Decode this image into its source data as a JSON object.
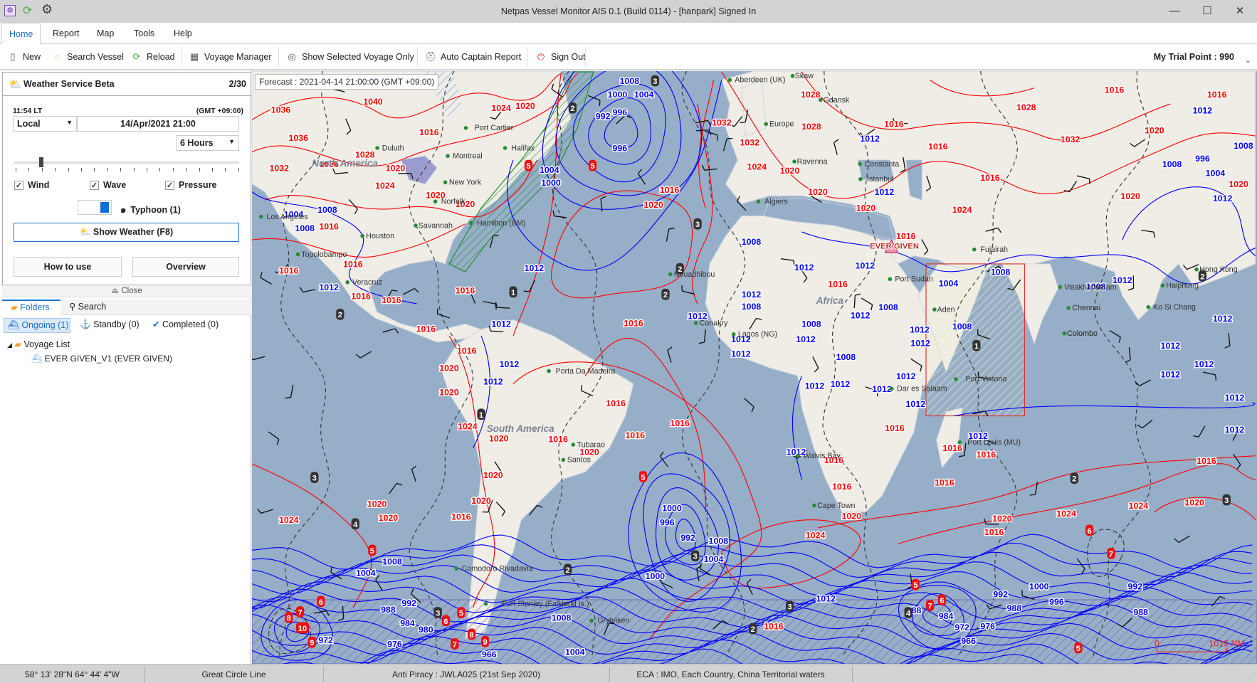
{
  "window": {
    "title": "Netpas Vessel Monitor AIS 0.1 (Build 0114) - [hanpark] Signed In",
    "minimize": "—",
    "maximize": "☐",
    "close": "✕"
  },
  "menu": {
    "items": [
      "Home",
      "Report",
      "Map",
      "Tools",
      "Help"
    ],
    "active": "Home"
  },
  "toolbar": {
    "new": "New",
    "search_vessel": "Search Vessel",
    "reload": "Reload",
    "voyage_manager": "Voyage Manager",
    "show_selected": "Show Selected Voyage Only",
    "auto_captain": "Auto Captain Report",
    "sign_out": "Sign Out",
    "trial_point": "My Trial Point : 990"
  },
  "weather": {
    "title": "Weather Service Beta",
    "count": "2/30",
    "local_time": "11:54 LT",
    "gmt": "(GMT +09:00)",
    "timezone": "Local",
    "datetime": "14/Apr/2021 21:00",
    "interval": "6 Hours",
    "slider_position": 0.12,
    "wind": "Wind",
    "wave": "Wave",
    "pressure": "Pressure",
    "wind_checked": true,
    "wave_checked": true,
    "pressure_checked": true,
    "typhoon": "Typhoon (1)",
    "show_weather": "Show Weather (F8)",
    "how_to_use": "How to use",
    "overview": "Overview",
    "close": "Close"
  },
  "folders": {
    "tab_folders": "Folders",
    "tab_search": "Search",
    "ongoing": "Ongoing (1)",
    "standby": "Standby (0)",
    "completed": "Completed (0)",
    "tree_root": "Voyage List",
    "tree_item": "EVER GIVEN_V1 (EVER GIVEN)"
  },
  "map": {
    "forecast": "Forecast : 2021-04-14 21:00:00 (GMT +09:00)",
    "vessel_label": "EVER GIVEN",
    "scale_zero": "0",
    "scale_distance": "1019 NM",
    "colors": {
      "ocean": "#97aec8",
      "land": "#efede6",
      "high_isobar": "#ff0000",
      "low_isobar": "#0000ff"
    },
    "red_isobar_labels": [
      "1040",
      "1036",
      "1036",
      "1032",
      "1036",
      "1028",
      "1020",
      "1024",
      "1020",
      "1016",
      "1024",
      "1020",
      "1020",
      "1016",
      "1016",
      "1016",
      "1016",
      "1016",
      "1016",
      "1016",
      "1016",
      "1016",
      "1020",
      "1020",
      "1024",
      "1020",
      "1016",
      "1016",
      "1016",
      "1016",
      "1020",
      "1020",
      "1020",
      "1016",
      "1020",
      "1020",
      "1024",
      "1016",
      "1020",
      "1032",
      "1028",
      "1028",
      "1032",
      "1024",
      "1020",
      "1016",
      "1016",
      "1028",
      "1032",
      "1016",
      "1024",
      "1016",
      "1016",
      "1016",
      "1016",
      "1016",
      "1020",
      "1016",
      "1016",
      "1016",
      "1024",
      "1016",
      "1016",
      "1020",
      "1024",
      "1024",
      "1020",
      "1016",
      "1016",
      "1020",
      "1016",
      "1020",
      "1020",
      "1020",
      "1020"
    ],
    "blue_isobar_labels": [
      "1008",
      "1000",
      "1004",
      "992",
      "996",
      "996",
      "1004",
      "1000",
      "1012",
      "1008",
      "1004",
      "1008",
      "1012",
      "1012",
      "1012",
      "1012",
      "1000",
      "996",
      "992",
      "1008",
      "1004",
      "1000",
      "1008",
      "1004",
      "992",
      "988",
      "984",
      "980",
      "976",
      "972",
      "966",
      "1004",
      "1008",
      "1012",
      "988",
      "984",
      "972",
      "976",
      "966",
      "988",
      "992",
      "996",
      "1000",
      "992",
      "988",
      "1012",
      "1012",
      "1004",
      "1008",
      "1012",
      "1012",
      "1008",
      "1012",
      "1008",
      "1012",
      "1012",
      "1012",
      "1012",
      "1008",
      "1012",
      "1008",
      "1012",
      "1008",
      "1012",
      "1012",
      "1012",
      "1012",
      "1008",
      "1012",
      "1012",
      "1012",
      "1012",
      "1012",
      "1008",
      "1004",
      "996",
      "1008",
      "1012",
      "1012",
      "1012",
      "1012",
      "1012",
      "1008",
      "1012",
      "1012",
      "1012"
    ],
    "wave_labels": [
      "3",
      "2",
      "3",
      "2",
      "1",
      "2",
      "3",
      "2",
      "4",
      "3",
      "2",
      "3",
      "2",
      "3",
      "4",
      "2",
      "3",
      "1",
      "1",
      "2"
    ],
    "wave_high_labels": [
      "5",
      "5",
      "5",
      "5",
      "5",
      "6",
      "7",
      "7",
      "8",
      "10",
      "9",
      "6",
      "5",
      "8",
      "9",
      "7",
      "6",
      "7",
      "5",
      "6"
    ],
    "places": [
      "Port Cartier",
      "Montreal",
      "New York",
      "Duluth",
      "Houston",
      "Savannah",
      "Hamilton (BM)",
      "Los Angeles",
      "Topolobampo",
      "Veracruz",
      "Norfolk",
      "Europe",
      "Ravenna",
      "Istanbul",
      "Constanta",
      "Algiers",
      "Nouadhibou",
      "Conakry",
      "Lagos (NG)",
      "Porta Da Madeira",
      "Port Sudan",
      "Aden",
      "Fujairah",
      "Chennai",
      "Colombo",
      "Hong Kong",
      "Haiphong",
      "Ko Si Chang",
      "Visakhapatnam",
      "Port Victoria",
      "Port Louis (MU)",
      "Dar es Salaam",
      "Walvis Bay",
      "Cape Town",
      "Tubarao",
      "Santos",
      "Comodoro Rivadavia",
      "Port Stanley (Falkland Is.)",
      "Grytviken",
      "Gdansk",
      "Aberdeen (UK)",
      "Skaw",
      "Halifax",
      "Colombo"
    ],
    "regions": [
      "North America",
      "Africa",
      "South America"
    ]
  },
  "status": {
    "coords": "58° 13' 28\"N 64° 44' 4\"W",
    "route": "Great Circle Line",
    "anti_piracy": "Anti Piracy : JWLA025 (21st Sep 2020)",
    "eca": "ECA : IMO, Each Country, China Territorial waters"
  }
}
